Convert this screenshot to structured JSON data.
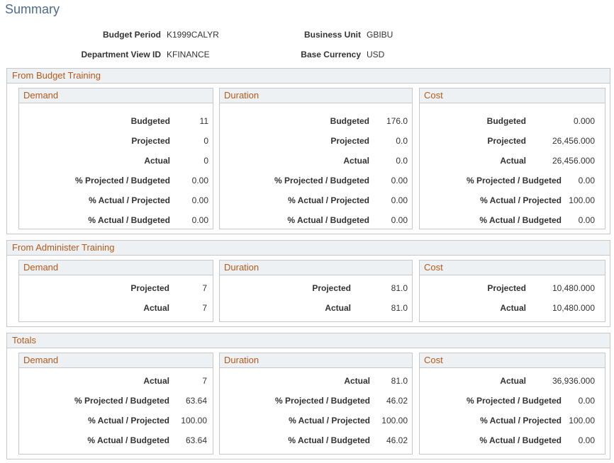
{
  "page": {
    "title": "Summary"
  },
  "header": {
    "budget_period_label": "Budget Period",
    "budget_period_value": "K1999CALYR",
    "business_unit_label": "Business Unit",
    "business_unit_value": "GBIBU",
    "dept_view_label": "Department View ID",
    "dept_view_value": "KFINANCE",
    "base_currency_label": "Base Currency",
    "base_currency_value": "USD"
  },
  "budget": {
    "title": "From Budget Training",
    "demand": {
      "title": "Demand",
      "rows": [
        {
          "label": "Budgeted",
          "value": "11"
        },
        {
          "label": "Projected",
          "value": "0"
        },
        {
          "label": "Actual",
          "value": "0"
        },
        {
          "label": "% Projected / Budgeted",
          "value": "0.00"
        },
        {
          "label": "% Actual / Projected",
          "value": "0.00"
        },
        {
          "label": "% Actual / Budgeted",
          "value": "0.00"
        }
      ]
    },
    "duration": {
      "title": "Duration",
      "rows": [
        {
          "label": "Budgeted",
          "value": "176.0"
        },
        {
          "label": "Projected",
          "value": "0.0"
        },
        {
          "label": "Actual",
          "value": "0.0"
        },
        {
          "label": "% Projected / Budgeted",
          "value": "0.00"
        },
        {
          "label": "% Actual / Projected",
          "value": "0.00"
        },
        {
          "label": "% Actual / Budgeted",
          "value": "0.00"
        }
      ]
    },
    "cost": {
      "title": "Cost",
      "rows": [
        {
          "label": "Budgeted",
          "value": "0.000"
        },
        {
          "label": "Projected",
          "value": "26,456.000"
        },
        {
          "label": "Actual",
          "value": "26,456.000"
        },
        {
          "label": "% Projected / Budgeted",
          "value": "0.00"
        },
        {
          "label": "% Actual / Projected",
          "value": "100.00"
        },
        {
          "label": "% Actual / Budgeted",
          "value": "0.00"
        }
      ]
    }
  },
  "administer": {
    "title": "From Administer Training",
    "demand": {
      "title": "Demand",
      "rows": [
        {
          "label": "Projected",
          "value": "7"
        },
        {
          "label": "Actual",
          "value": "7"
        }
      ]
    },
    "duration": {
      "title": "Duration",
      "rows": [
        {
          "label": "Projected",
          "value": "81.0"
        },
        {
          "label": "Actual",
          "value": "81.0"
        }
      ]
    },
    "cost": {
      "title": "Cost",
      "rows": [
        {
          "label": "Projected",
          "value": "10,480.000"
        },
        {
          "label": "Actual",
          "value": "10,480.000"
        }
      ]
    }
  },
  "totals": {
    "title": "Totals",
    "demand": {
      "title": "Demand",
      "rows": [
        {
          "label": "Actual",
          "value": "7"
        },
        {
          "label": "% Projected / Budgeted",
          "value": "63.64"
        },
        {
          "label": "% Actual / Projected",
          "value": "100.00"
        },
        {
          "label": "% Actual / Budgeted",
          "value": "63.64"
        }
      ]
    },
    "duration": {
      "title": "Duration",
      "rows": [
        {
          "label": "Actual",
          "value": "81.0"
        },
        {
          "label": "% Projected / Budgeted",
          "value": "46.02"
        },
        {
          "label": "% Actual / Projected",
          "value": "100.00"
        },
        {
          "label": "% Actual / Budgeted",
          "value": "46.02"
        }
      ]
    },
    "cost": {
      "title": "Cost",
      "rows": [
        {
          "label": "Actual",
          "value": "36,936.000"
        },
        {
          "label": "% Projected / Budgeted",
          "value": "0.00"
        },
        {
          "label": "% Actual / Projected",
          "value": "100.00"
        },
        {
          "label": "% Actual / Budgeted",
          "value": "0.00"
        }
      ]
    }
  }
}
